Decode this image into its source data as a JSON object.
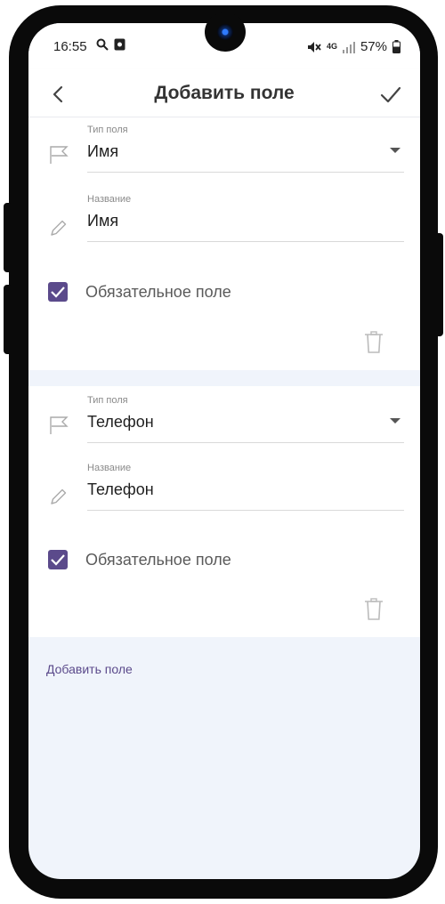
{
  "status_bar": {
    "time": "16:55",
    "network": "4G",
    "battery": "57%",
    "icons": [
      "search-icon",
      "screenshot-icon",
      "mute-icon",
      "signal-icon",
      "battery-icon"
    ]
  },
  "header": {
    "title": "Добавить поле",
    "back_icon": "back-arrow-icon",
    "confirm_icon": "check-icon"
  },
  "fields": [
    {
      "type_label": "Тип поля",
      "type_value": "Имя",
      "name_label": "Название",
      "name_value": "Имя",
      "required_label": "Обязательное поле",
      "required": true
    },
    {
      "type_label": "Тип поля",
      "type_value": "Телефон",
      "name_label": "Название",
      "name_value": "Телефон",
      "required_label": "Обязательное поле",
      "required": true
    }
  ],
  "add_field_link": "Добавить поле",
  "colors": {
    "accent": "#5b4a8b",
    "background": "#f0f4fb",
    "card": "#ffffff"
  }
}
